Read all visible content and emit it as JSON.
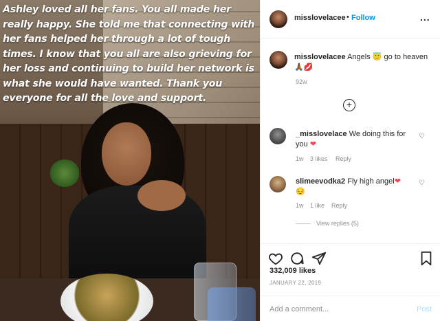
{
  "photo": {
    "caption": "Ashley loved all her fans. You all made her really happy. She told me that connecting with her fans helped her through a lot of tough times. I know that you all are also grieving for her loss and continuing to build her network is what she would have wanted. Thank you everyone for all the love and support."
  },
  "header": {
    "username": "misslovelacee",
    "dot": "•",
    "follow_label": "Follow",
    "more": "..."
  },
  "caption_comment": {
    "username": "misslovelacee",
    "text_before": "Angels",
    "text_after": "go to heaven",
    "emoji_angel": "😇",
    "emoji_hands": "🙏🏾",
    "emoji_lips": "💋",
    "time": "92w"
  },
  "comments": [
    {
      "username": "_misslovelace",
      "text": "We doing this for you",
      "heart": "❤",
      "time": "1w",
      "likes": "3 likes",
      "reply": "Reply"
    },
    {
      "username": "slimeevodka2",
      "text": "Fly high angel",
      "heart": "❤",
      "emoji": "😔",
      "time": "1w",
      "likes": "1 like",
      "reply": "Reply",
      "view_replies": "View replies (5)"
    }
  ],
  "post": {
    "likes": "332,009 likes",
    "date": "JANUARY 22, 2019"
  },
  "composer": {
    "placeholder": "Add a comment...",
    "post_label": "Post"
  },
  "icons": {
    "like": "heart-icon",
    "comment": "comment-icon",
    "share": "share-icon",
    "save": "bookmark-icon",
    "add_comments": "plus-circle-icon",
    "more": "more-options-icon"
  },
  "colors": {
    "accent": "#0095f6",
    "heart": "#ed4956",
    "muted": "#8e8e8e"
  }
}
